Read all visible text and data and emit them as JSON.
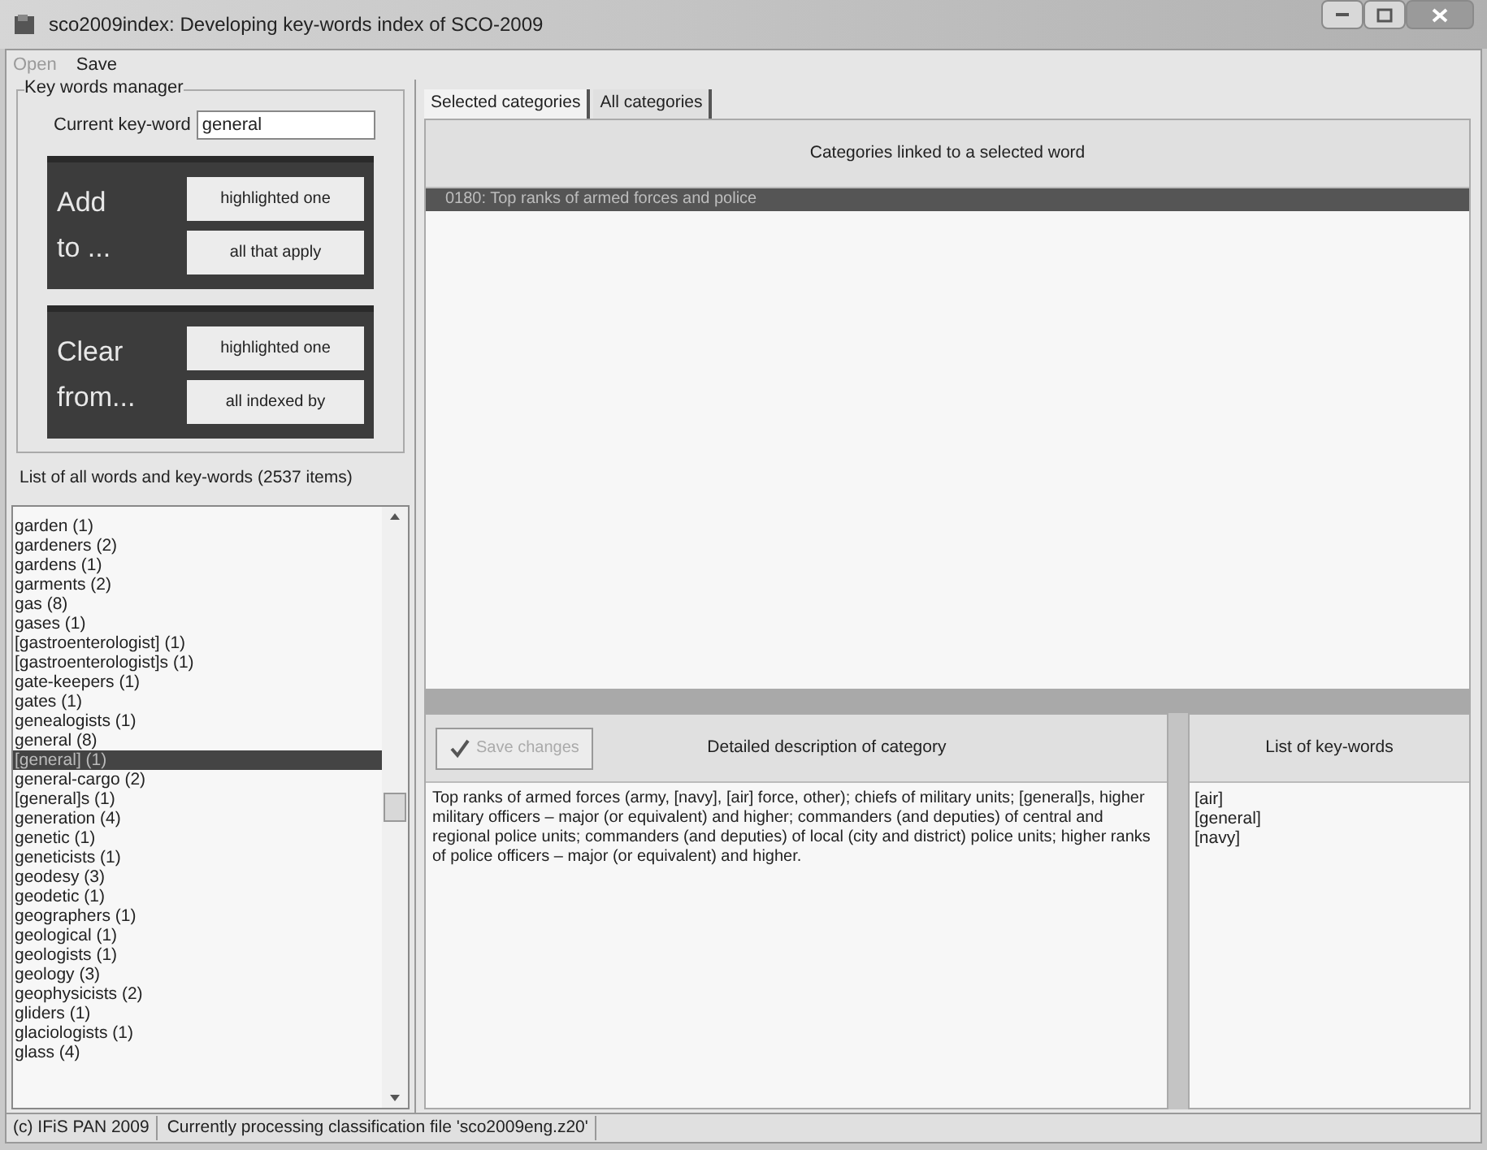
{
  "window": {
    "title": "sco2009index: Developing key-words index of SCO-2009"
  },
  "menu": [
    {
      "label": "Open",
      "disabled": true
    },
    {
      "label": "Save",
      "disabled": false
    }
  ],
  "key_words_manager": {
    "title": "Key words manager",
    "current_label": "Current key-word",
    "current_value": "general",
    "groups": [
      {
        "label_lines": [
          "Add",
          "to ..."
        ],
        "buttons": [
          "highlighted one",
          "all that apply"
        ]
      },
      {
        "label_lines": [
          "Clear",
          "from..."
        ],
        "buttons": [
          "highlighted one",
          "all indexed by"
        ]
      }
    ]
  },
  "word_list": {
    "title": "List of all words and key-words (2537 items)",
    "items": [
      {
        "text": "garden (1)",
        "selected": false
      },
      {
        "text": "gardeners (2)",
        "selected": false
      },
      {
        "text": "gardens (1)",
        "selected": false
      },
      {
        "text": "garments (2)",
        "selected": false
      },
      {
        "text": "gas (8)",
        "selected": false
      },
      {
        "text": "gases (1)",
        "selected": false
      },
      {
        "text": "[gastroenterologist] (1)",
        "selected": false
      },
      {
        "text": "[gastroenterologist]s (1)",
        "selected": false
      },
      {
        "text": "gate-keepers (1)",
        "selected": false
      },
      {
        "text": "gates (1)",
        "selected": false
      },
      {
        "text": "genealogists (1)",
        "selected": false
      },
      {
        "text": "general (8)",
        "selected": false
      },
      {
        "text": "[general] (1)",
        "selected": true
      },
      {
        "text": "general-cargo (2)",
        "selected": false
      },
      {
        "text": "[general]s (1)",
        "selected": false
      },
      {
        "text": "generation (4)",
        "selected": false
      },
      {
        "text": "genetic (1)",
        "selected": false
      },
      {
        "text": "geneticists (1)",
        "selected": false
      },
      {
        "text": "geodesy (3)",
        "selected": false
      },
      {
        "text": "geodetic (1)",
        "selected": false
      },
      {
        "text": "geographers (1)",
        "selected": false
      },
      {
        "text": "geological (1)",
        "selected": false
      },
      {
        "text": "geologists (1)",
        "selected": false
      },
      {
        "text": "geology (3)",
        "selected": false
      },
      {
        "text": "geophysicists (2)",
        "selected": false
      },
      {
        "text": "gliders (1)",
        "selected": false
      },
      {
        "text": "glaciologists (1)",
        "selected": false
      },
      {
        "text": "glass (4)",
        "selected": false
      }
    ]
  },
  "tabs": [
    {
      "label": "Selected categories",
      "selected": true
    },
    {
      "label": "All categories",
      "selected": false
    }
  ],
  "categories": {
    "title": "Categories linked to a selected word",
    "items": [
      {
        "text": "0180: Top ranks of armed forces and police",
        "selected": true
      }
    ]
  },
  "description": {
    "save_button": {
      "label": "Save changes",
      "disabled": true
    },
    "title": "Detailed description of category",
    "text": "Top ranks of armed forces (army, [navy], [air] force, other); chiefs of military units; [general]s, higher military officers – major (or equivalent) and higher; commanders (and deputies) of central and regional police units; commanders (and deputies) of local (city and district) police units; higher ranks of police officers – major (or equivalent) and higher."
  },
  "key_words": {
    "title": "List of key-words",
    "items": [
      "[air]",
      "[general]",
      "[navy]"
    ]
  },
  "status_bar": [
    "(c) IFiS PAN 2009",
    "Currently processing classification file 'sco2009eng.z20'"
  ]
}
